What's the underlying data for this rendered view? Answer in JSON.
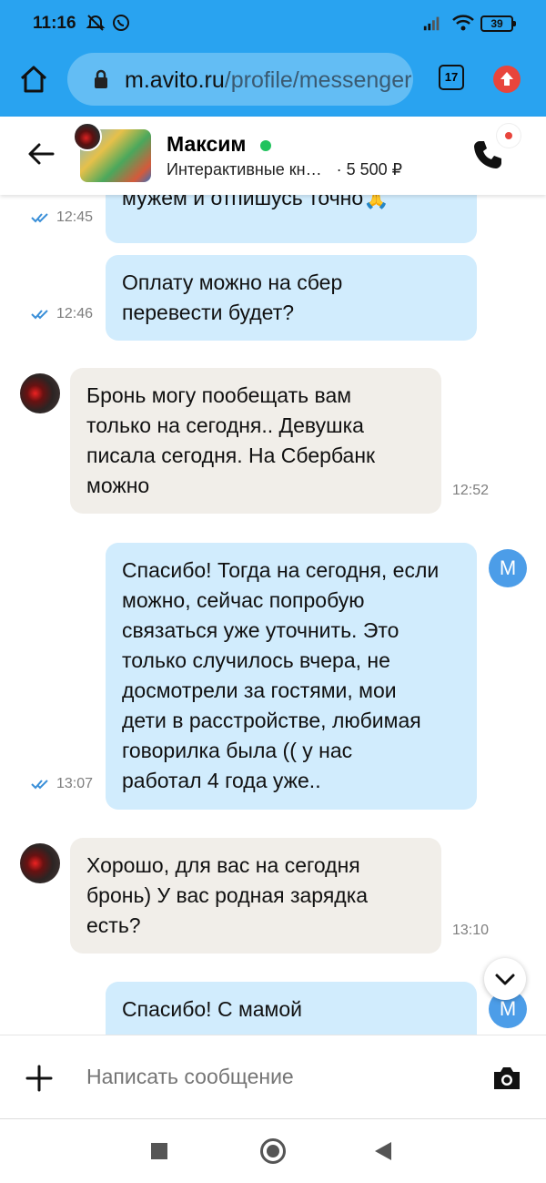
{
  "status_bar": {
    "time": "11:16",
    "battery": "39"
  },
  "browser": {
    "url_host": "m.avito.ru",
    "url_path": "/profile/messenger",
    "tab_count": "17"
  },
  "chat_header": {
    "name": "Максим",
    "listing_title": "Интерактивные кн…",
    "price": "· 5 500 ₽"
  },
  "messages": [
    {
      "direction": "out",
      "lines": [
        "мужем и отпишусь точно🙏"
      ],
      "time": "12:45",
      "read": true
    },
    {
      "direction": "out",
      "lines": [
        "Оплату можно на сбер",
        "перевести будет?"
      ],
      "time": "12:46",
      "read": true
    },
    {
      "direction": "in",
      "lines": [
        "Бронь могу пообещать вам",
        "только на сегодня.. Девушка",
        "писала сегодня. На Сбербанк",
        "можно"
      ],
      "time": "12:52"
    },
    {
      "direction": "out",
      "lines": [
        "Спасибо! Тогда на сегодня, если",
        "можно, сейчас попробую",
        "связаться уже уточнить. Это",
        "только случилось вчера, не",
        "досмотрели за гостями, мои",
        "дети в расстройстве, любимая",
        "говорилка была (( у нас",
        "работал 4 года уже.."
      ],
      "time": "13:07",
      "read": true,
      "sender_initial": "M"
    },
    {
      "direction": "in",
      "lines": [
        "Хорошо, для вас на сегодня",
        "бронь) У вас родная зарядка",
        "есть?"
      ],
      "time": "13:10"
    },
    {
      "direction": "out",
      "lines": [
        "Спасибо! С мамой"
      ],
      "time": "",
      "sender_initial": "M"
    }
  ],
  "composer": {
    "placeholder": "Написать сообщение"
  },
  "icons": [
    "home-icon",
    "lock-icon",
    "tabs-icon",
    "update-icon",
    "back-arrow-icon",
    "phone-icon",
    "chevron-down-icon",
    "plus-icon",
    "camera-icon",
    "double-check-icon"
  ],
  "colors": {
    "accent": "#29a3f0",
    "outgoing_bubble": "#d1ecfd",
    "incoming_bubble": "#f1eee9",
    "online": "#22c35e"
  }
}
